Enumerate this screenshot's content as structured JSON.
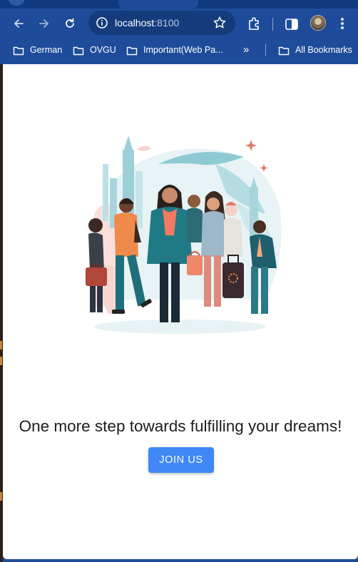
{
  "browser": {
    "url_host": "localhost",
    "url_port": ":8100",
    "icons": {
      "back": "arrow-left-icon",
      "forward": "arrow-right-icon",
      "reload": "reload-icon",
      "site_info": "site-info-icon",
      "bookmark_star": "star-icon",
      "extensions": "puzzle-icon",
      "side_panel": "side-panel-icon",
      "profile": "avatar",
      "menu": "kebab-menu-icon"
    }
  },
  "bookmarks": {
    "items": [
      {
        "label": "German"
      },
      {
        "label": "OVGU"
      },
      {
        "label": "Important(Web Pa..."
      }
    ],
    "more_label": "»",
    "all_bookmarks_label": "All Bookmarks"
  },
  "page": {
    "headline": "One more step towards fulfilling your dreams!",
    "join_label": "JOIN US",
    "accent_color": "#3f88f5"
  }
}
